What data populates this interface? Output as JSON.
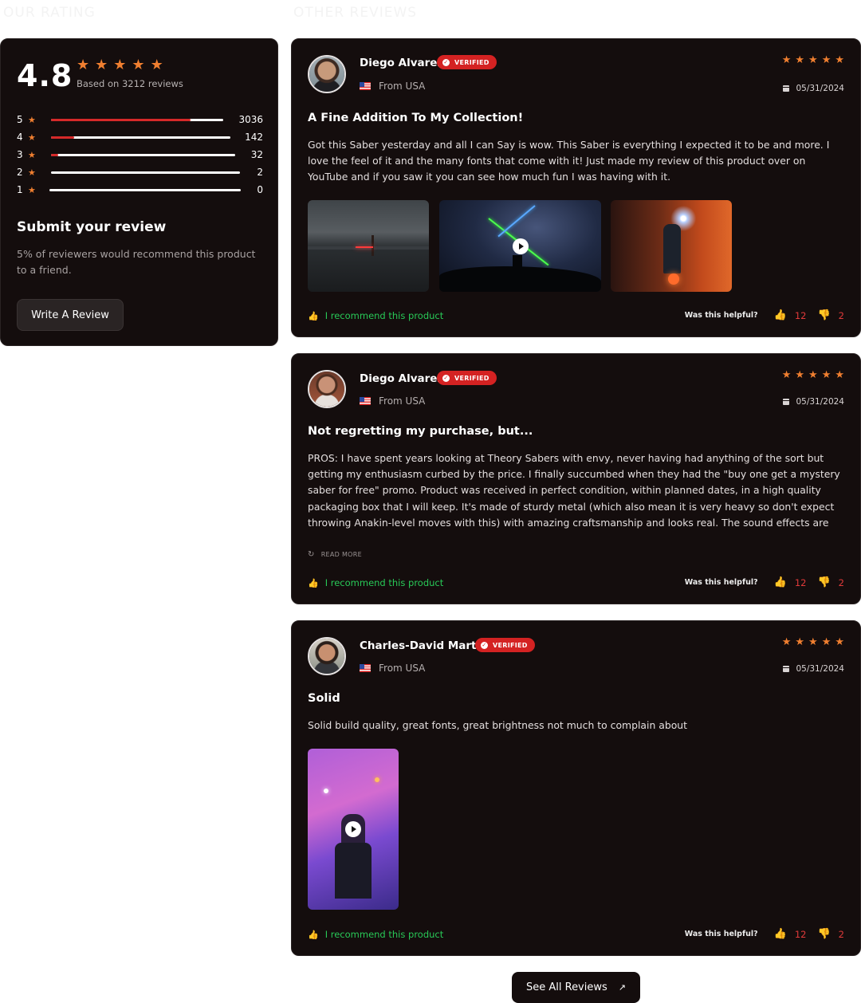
{
  "headings": {
    "left": "OUR RATING",
    "right": "OTHER REVIEWS"
  },
  "summary": {
    "score": "4.8",
    "based_on": "Based on 3212 reviews",
    "distribution": [
      {
        "label": "5",
        "count": "3036",
        "fill": 0.81
      },
      {
        "label": "4",
        "count": "142",
        "fill": 0.13
      },
      {
        "label": "3",
        "count": "32",
        "fill": 0.04
      },
      {
        "label": "2",
        "count": "2",
        "fill": 0
      },
      {
        "label": "1",
        "count": "0",
        "fill": 0
      }
    ],
    "submit_title": "Submit your review",
    "submit_desc": "5% of reviewers would recommend this product to a friend.",
    "write_button": "Write A Review"
  },
  "reviews": [
    {
      "name": "Diego Alvarez",
      "verified": "VERIFIED",
      "from": "From USA",
      "date": "05/31/2024",
      "title": "A Fine Addition To My Collection!",
      "body": "Got this Saber yesterday and all I can Say is wow. This Saber is everything I expected it to be and more. I love the feel of it and the many fonts that come with it! Just made my review of this product over on YouTube and if you saw it you can see how much fun I was having with it.",
      "recommend": "I recommend this product",
      "helpful_label": "Was this helpful?",
      "up": "12",
      "down": "2"
    },
    {
      "name": "Diego Alvarez",
      "verified": "VERIFIED",
      "from": "From USA",
      "date": "05/31/2024",
      "title": "Not regretting my purchase, but...",
      "body": "PROS: I have spent years looking at Theory Sabers with envy, never having had anything of the sort but getting my enthusiasm curbed by the price. I finally succumbed when they had the \"buy one get a mystery saber for free\" promo. Product was received in perfect condition, within planned dates, in a high quality packaging box that I will keep. It's made of sturdy metal (which also mean it is very heavy so don't expect throwing Anakin-level moves with this) with amazing craftsmanship and looks real. The sound effects are extensive and highl...",
      "read_more": "READ MORE",
      "recommend": "I recommend this product",
      "helpful_label": "Was this helpful?",
      "up": "12",
      "down": "2"
    },
    {
      "name": "Charles-David Martel",
      "verified": "VERIFIED",
      "from": "From USA",
      "date": "05/31/2024",
      "title": "Solid",
      "body": "Solid build quality, great fonts, great brightness not much to complain about",
      "recommend": "I recommend this product",
      "helpful_label": "Was this helpful?",
      "up": "12",
      "down": "2"
    }
  ],
  "see_all": "See All Reviews",
  "icons": {
    "star": "star-icon",
    "verified": "verified-badge-icon",
    "flag": "us-flag-icon",
    "calendar": "calendar-icon",
    "play": "play-icon",
    "thumb_up": "thumbs-up-icon",
    "thumb_down": "thumbs-down-icon",
    "refresh": "refresh-icon",
    "arrow": "arrow-up-right-icon"
  },
  "colors": {
    "card": "#140d0d",
    "accent_red": "#d42222",
    "star": "#f07f30",
    "recommend": "#28c957"
  }
}
